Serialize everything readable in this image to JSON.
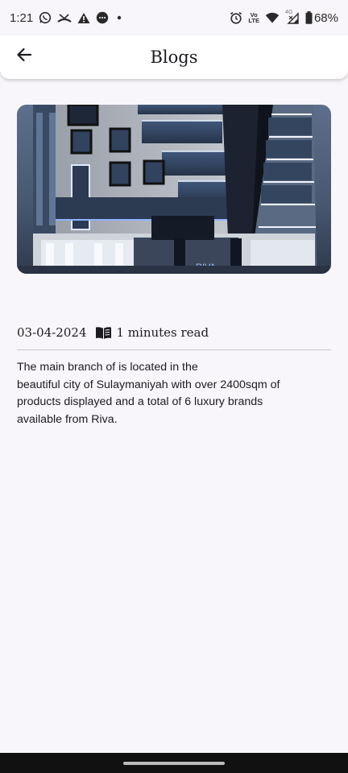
{
  "status_bar": {
    "time": "1:21",
    "network_label_top": "Vo",
    "network_label_bottom": "LTE",
    "signal_label": "4G",
    "battery": "68%",
    "left_icons": [
      "whatsapp-icon",
      "missed-call-icon",
      "warning-icon",
      "message-icon",
      "dot-icon"
    ],
    "right_icons": [
      "alarm-icon",
      "volte-icon",
      "wifi-icon",
      "signal-icon",
      "battery-icon"
    ]
  },
  "app_bar": {
    "title": "Blogs",
    "back_icon": "arrow-back-icon"
  },
  "article": {
    "image_caption_logo": "RIVA",
    "date": "03-04-2024",
    "read_icon": "book-open-icon",
    "read_time": "1 minutes read",
    "body_lines": [
      "The main branch of is located in the",
      "beautiful city of Sulaymaniyah with over 2400sqm of",
      "products displayed and a total of 6 luxury brands",
      "available from Riva."
    ]
  },
  "colors": {
    "background": "#f8f6fa",
    "app_bar": "#ffffff",
    "text": "#1c1b1f",
    "divider": "#c9c6cc",
    "nav_bar": "#111111"
  }
}
